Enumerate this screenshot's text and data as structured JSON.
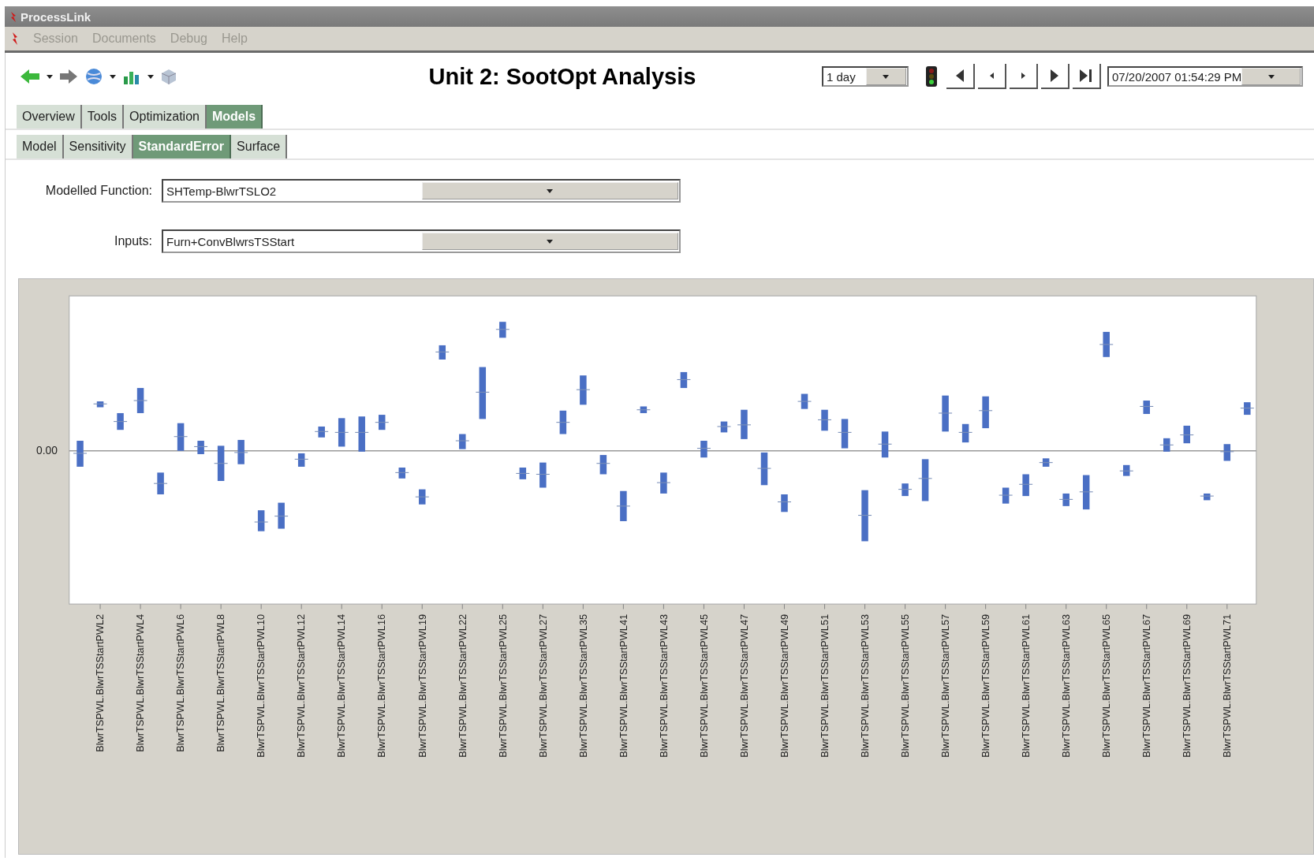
{
  "window": {
    "title": "ProcessLink"
  },
  "menu": [
    "Session",
    "Documents",
    "Debug",
    "Help"
  ],
  "page_title": "Unit 2: SootOpt Analysis",
  "time_range": {
    "value": "1 day"
  },
  "timestamp": {
    "value": "07/20/2007 01:54:29 PM"
  },
  "tabs": [
    {
      "label": "Overview",
      "selected": false
    },
    {
      "label": "Tools",
      "selected": false
    },
    {
      "label": "Optimization",
      "selected": false
    },
    {
      "label": "Models",
      "selected": true
    }
  ],
  "subtabs": [
    {
      "label": "Model",
      "selected": false
    },
    {
      "label": "Sensitivity",
      "selected": false
    },
    {
      "label": "StandardError",
      "selected": true
    },
    {
      "label": "Surface",
      "selected": false
    }
  ],
  "fields": [
    {
      "label": "Modelled Function:",
      "value": "SHTemp-BlwrTSLO2"
    },
    {
      "label": "Inputs:",
      "value": "Furn+ConvBlwrsTSStart"
    }
  ],
  "chart": {
    "y_tick_label": "0.00",
    "x_labels": [
      "BlwrTSPWL.BlwrTSStartPWL2",
      "BlwrTSPWL.BlwrTSStartPWL4",
      "BlwrTSPWL.BlwrTSStartPWL6",
      "BlwrTSPWL.BlwrTSStartPWL8",
      "BlwrTSPWL.BlwrTSStartPWL10",
      "BlwrTSPWL.BlwrTSStartPWL12",
      "BlwrTSPWL.BlwrTSStartPWL14",
      "BlwrTSPWL.BlwrTSStartPWL16",
      "BlwrTSPWL.BlwrTSStartPWL19",
      "BlwrTSPWL.BlwrTSStartPWL22",
      "BlwrTSPWL.BlwrTSStartPWL25",
      "BlwrTSPWL.BlwrTSStartPWL27",
      "BlwrTSPWL.BlwrTSStartPWL35",
      "BlwrTSPWL.BlwrTSStartPWL41",
      "BlwrTSPWL.BlwrTSStartPWL43",
      "BlwrTSPWL.BlwrTSStartPWL45",
      "BlwrTSPWL.BlwrTSStartPWL47",
      "BlwrTSPWL.BlwrTSStartPWL49",
      "BlwrTSPWL.BlwrTSStartPWL51",
      "BlwrTSPWL.BlwrTSStartPWL53",
      "BlwrTSPWL.BlwrTSStartPWL55",
      "BlwrTSPWL.BlwrTSStartPWL57",
      "BlwrTSPWL.BlwrTSStartPWL59",
      "BlwrTSPWL.BlwrTSStartPWL61",
      "BlwrTSPWL.BlwrTSStartPWL63",
      "BlwrTSPWL.BlwrTSStartPWL65",
      "BlwrTSPWL.BlwrTSStartPWL67",
      "BlwrTSPWL.BlwrTSStartPWL69",
      "BlwrTSPWL.BlwrTSStartPWL71"
    ]
  }
}
